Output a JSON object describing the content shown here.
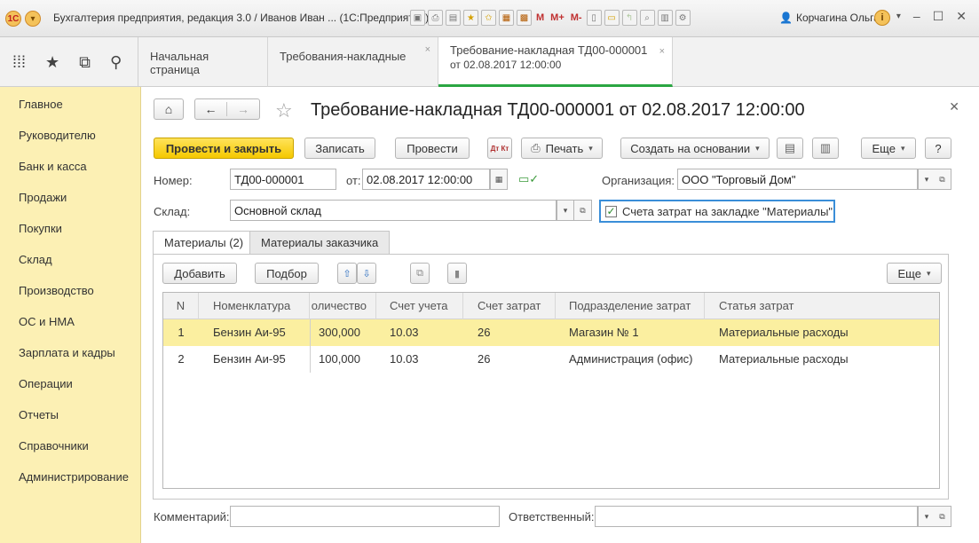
{
  "window": {
    "title": "Бухгалтерия предприятия, редакция 3.0 / Иванов Иван ... (1С:Предприятие)",
    "logo": "1С",
    "user": "Корчагина Ольга",
    "m_labels": [
      "M",
      "M+",
      "M-"
    ]
  },
  "topnav": {
    "tabs": [
      {
        "label": "Начальная страница"
      },
      {
        "label": "Требования-накладные",
        "close": "×"
      },
      {
        "label_line1": "Требование-накладная ТД00-000001",
        "label_line2": "от 02.08.2017 12:00:00",
        "close": "×"
      }
    ]
  },
  "sidebar": {
    "items": [
      "Главное",
      "Руководителю",
      "Банк и касса",
      "Продажи",
      "Покупки",
      "Склад",
      "Производство",
      "ОС и НМА",
      "Зарплата и кадры",
      "Операции",
      "Отчеты",
      "Справочники",
      "Администрирование"
    ]
  },
  "document": {
    "title": "Требование-накладная ТД00-000001 от 02.08.2017 12:00:00",
    "toolbar": {
      "post_close": "Провести и закрыть",
      "save": "Записать",
      "post": "Провести",
      "dtkt": "Дт Кт",
      "print": "Печать",
      "create_based": "Создать на основании",
      "more": "Еще",
      "help": "?"
    },
    "fields": {
      "number_label": "Номер:",
      "number_value": "ТД00-000001",
      "date_label": "от:",
      "date_value": "02.08.2017 12:00:00",
      "org_label": "Организация:",
      "org_value": "ООО \"Торговый Дом\"",
      "warehouse_label": "Склад:",
      "warehouse_value": "Основной склад",
      "checkbox_label": "Счета затрат на закладке \"Материалы\"",
      "checkbox_checked": true
    },
    "inner_tabs": [
      "Материалы (2)",
      "Материалы заказчика"
    ],
    "table_toolbar": {
      "add": "Добавить",
      "select": "Подбор",
      "more": "Еще"
    },
    "table": {
      "headers": [
        "N",
        "Номенклатура",
        "оличество",
        "Счет учета",
        "Счет затрат",
        "Подразделение затрат",
        "Статья затрат"
      ],
      "rows": [
        [
          "1",
          "Бензин Аи-95",
          "300,000",
          "10.03",
          "26",
          "Магазин № 1",
          "Материальные расходы"
        ],
        [
          "2",
          "Бензин Аи-95",
          "100,000",
          "10.03",
          "26",
          "Администрация (офис)",
          "Материальные расходы"
        ]
      ]
    },
    "footer": {
      "comment_label": "Комментарий:",
      "comment_value": "",
      "responsible_label": "Ответственный:",
      "responsible_value": ""
    }
  }
}
